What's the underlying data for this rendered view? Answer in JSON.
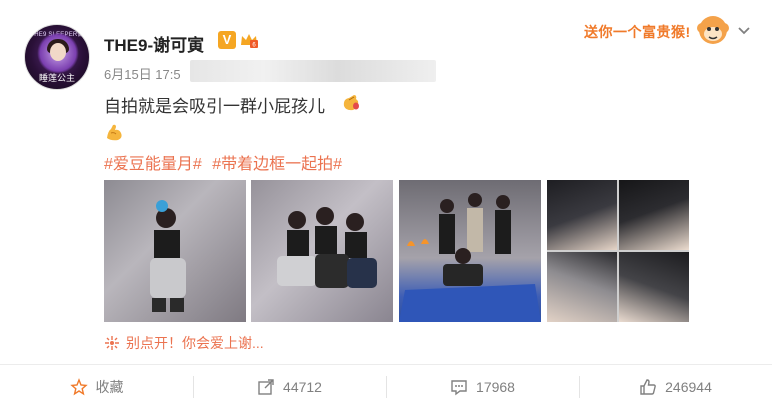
{
  "post": {
    "avatar_top_text": "THE9 SLEEPER做",
    "avatar_bottom_text": "睡莲公主",
    "username": "THE9-谢可寅",
    "verified_badge": "V",
    "time": "6月15日 17:5",
    "text": "自拍就是会吸引一群小屁孩儿",
    "tags": [
      "#爱豆能量月#",
      "#带着边框一起拍#"
    ],
    "spoiler": "别点开！你会爱上谢..."
  },
  "header": {
    "promo_text": "送你一个富贵猴!"
  },
  "actions": {
    "favorite_label": "收藏",
    "repost_count": "44712",
    "comment_count": "17968",
    "like_count": "246944"
  },
  "colors": {
    "accent": "#eb7350",
    "badge": "#f5a623",
    "muted": "#808080"
  }
}
